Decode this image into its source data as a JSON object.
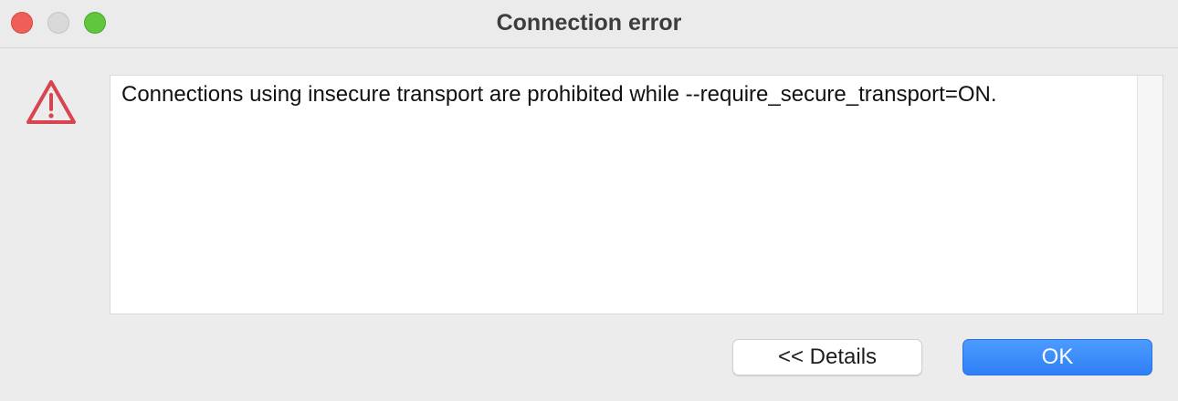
{
  "window": {
    "title": "Connection error"
  },
  "dialog": {
    "icon": "warning-triangle-icon",
    "message": "Connections using insecure transport are prohibited while --require_secure_transport=ON.",
    "buttons": {
      "details_label": "<< Details",
      "ok_label": "OK"
    }
  },
  "colors": {
    "accent": "#2f7ff6",
    "warning_icon": "#d64550",
    "close": "#ee5f58",
    "minimize": "#d9d9d9",
    "zoom": "#5fc63d"
  }
}
